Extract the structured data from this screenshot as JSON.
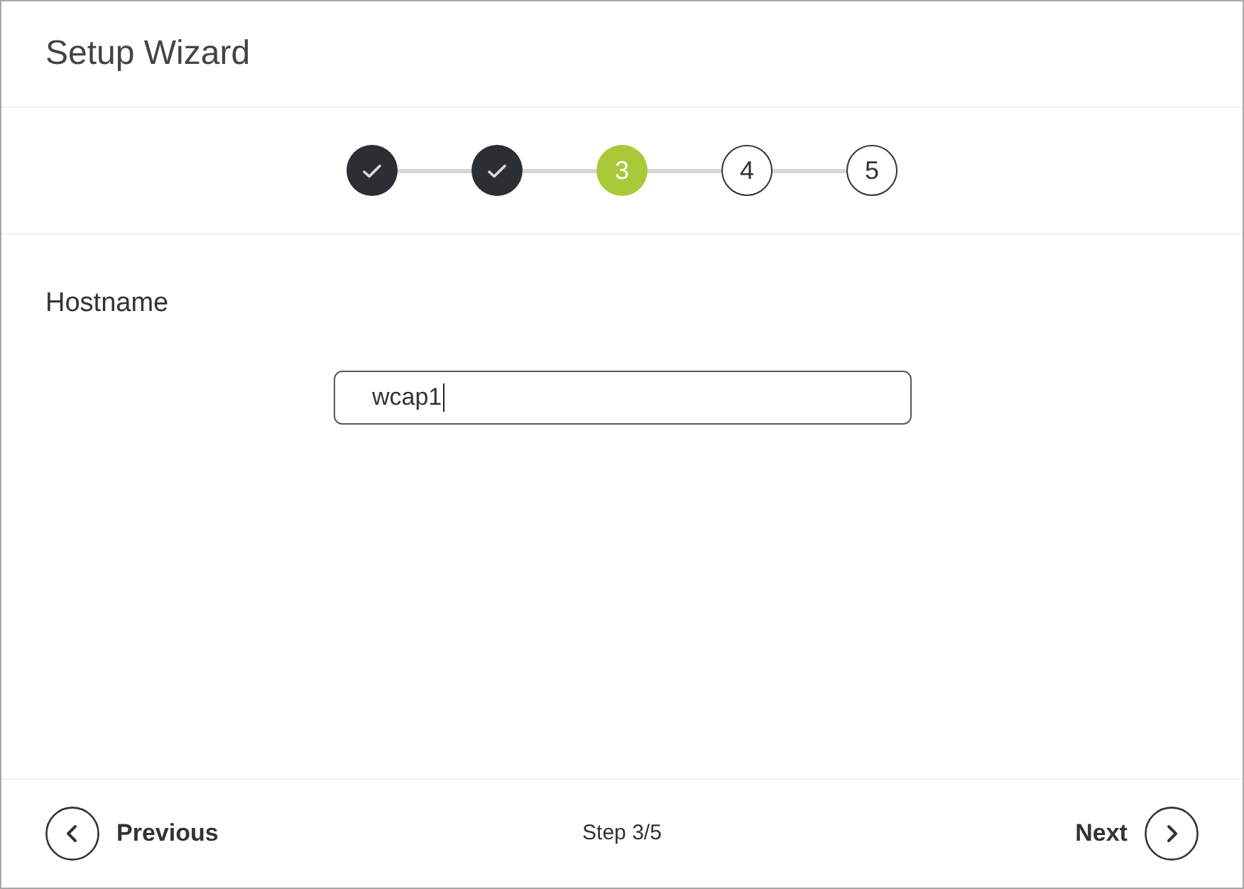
{
  "window": {
    "title": "Setup Wizard"
  },
  "steps": [
    {
      "kind": "done"
    },
    {
      "kind": "done"
    },
    {
      "kind": "current",
      "label": "3"
    },
    {
      "kind": "pending",
      "label": "4"
    },
    {
      "kind": "pending",
      "label": "5"
    }
  ],
  "form": {
    "label": "Hostname",
    "value": "wcap1",
    "focused": true
  },
  "footer": {
    "previous": "Previous",
    "step_text": "Step 3/5",
    "next": "Next"
  }
}
